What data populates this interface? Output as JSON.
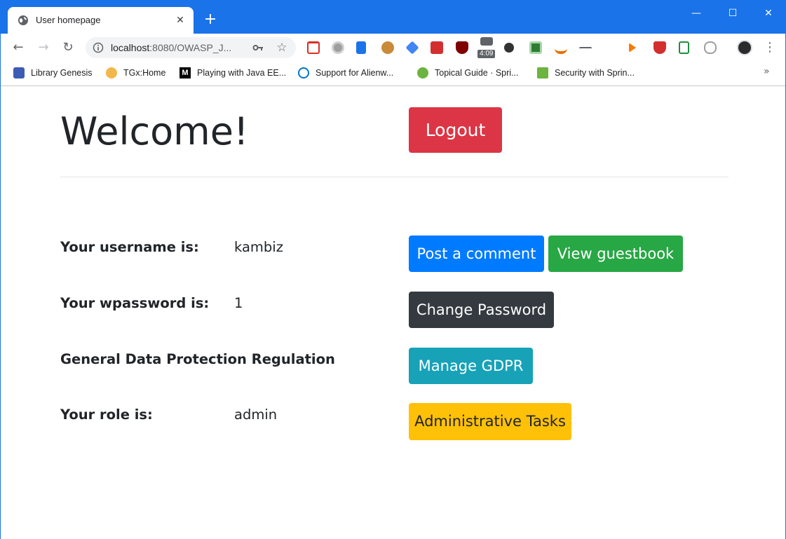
{
  "browser": {
    "tab_title": "User homepage",
    "tab_close": "✕",
    "new_tab": "+",
    "window_controls": {
      "minimize": "—",
      "maximize": "☐",
      "close": "✕"
    },
    "nav": {
      "back": "←",
      "forward": "→",
      "reload": "↻"
    },
    "url_host": "localhost",
    "url_rest": ":8080/OWASP_J...",
    "star": "☆",
    "menu": "⋮",
    "extension_badge": "4:09",
    "bookmarks_more": "»",
    "bookmarks": [
      {
        "label": "Library Genesis",
        "icon": "library-genesis-icon",
        "color": "#3b5bb5"
      },
      {
        "label": "TGx:Home",
        "icon": "tgx-icon",
        "color": "#f2b84b"
      },
      {
        "label": "Playing with Java EE...",
        "icon": "medium-icon",
        "color": "#000000"
      },
      {
        "label": "Support for Alienw...",
        "icon": "dell-icon",
        "color": "#0076ce"
      },
      {
        "label": "Topical Guide · Spri...",
        "icon": "spring-icon",
        "color": "#6db33f"
      },
      {
        "label": "Security with Sprin...",
        "icon": "spring-leaf-icon",
        "color": "#6db33f"
      }
    ]
  },
  "page": {
    "heading": "Welcome!",
    "logout": "Logout",
    "rows": [
      {
        "label": "Your username is:",
        "value": "kambiz"
      },
      {
        "label": "Your wpassword is:",
        "value": "1"
      },
      {
        "label": "General Data Protection Regulation",
        "value": ""
      },
      {
        "label": "Your role is:",
        "value": "admin"
      }
    ],
    "buttons": {
      "post_comment": "Post a comment",
      "view_guestbook": "View guestbook",
      "change_password": "Change Password",
      "manage_gdpr": "Manage GDPR",
      "admin_tasks": "Administrative Tasks"
    },
    "colors": {
      "danger": "#dc3545",
      "primary": "#007bff",
      "success": "#28a745",
      "dark": "#343a40",
      "info": "#17a2b8",
      "warning": "#ffc107"
    }
  }
}
